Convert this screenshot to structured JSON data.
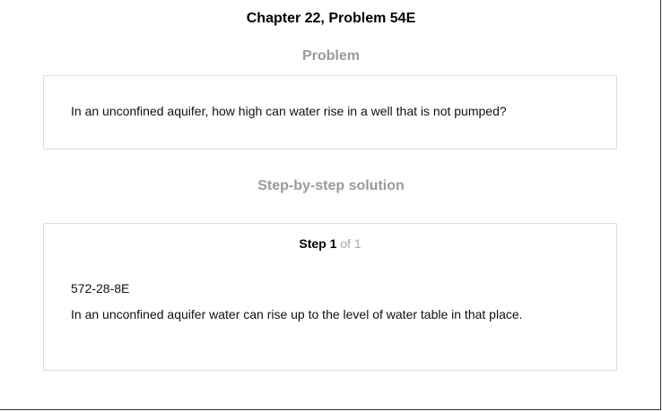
{
  "header": {
    "title": "Chapter 22, Problem 54E"
  },
  "problem": {
    "heading": "Problem",
    "text": "In an unconfined aquifer, how high can water rise in a well that is not pumped?"
  },
  "solution": {
    "heading": "Step-by-step solution",
    "step_label": "Step 1",
    "step_of": "of 1",
    "id_text": "572-28-8E",
    "text": "In an unconfined aquifer water can rise up to the level of water table in that place."
  },
  "colors": {
    "heading_gray": "#9a9a9a",
    "card_border": "#dcdcdc",
    "step_of_gray": "#aaaaaa",
    "frame_border": "#333333"
  }
}
